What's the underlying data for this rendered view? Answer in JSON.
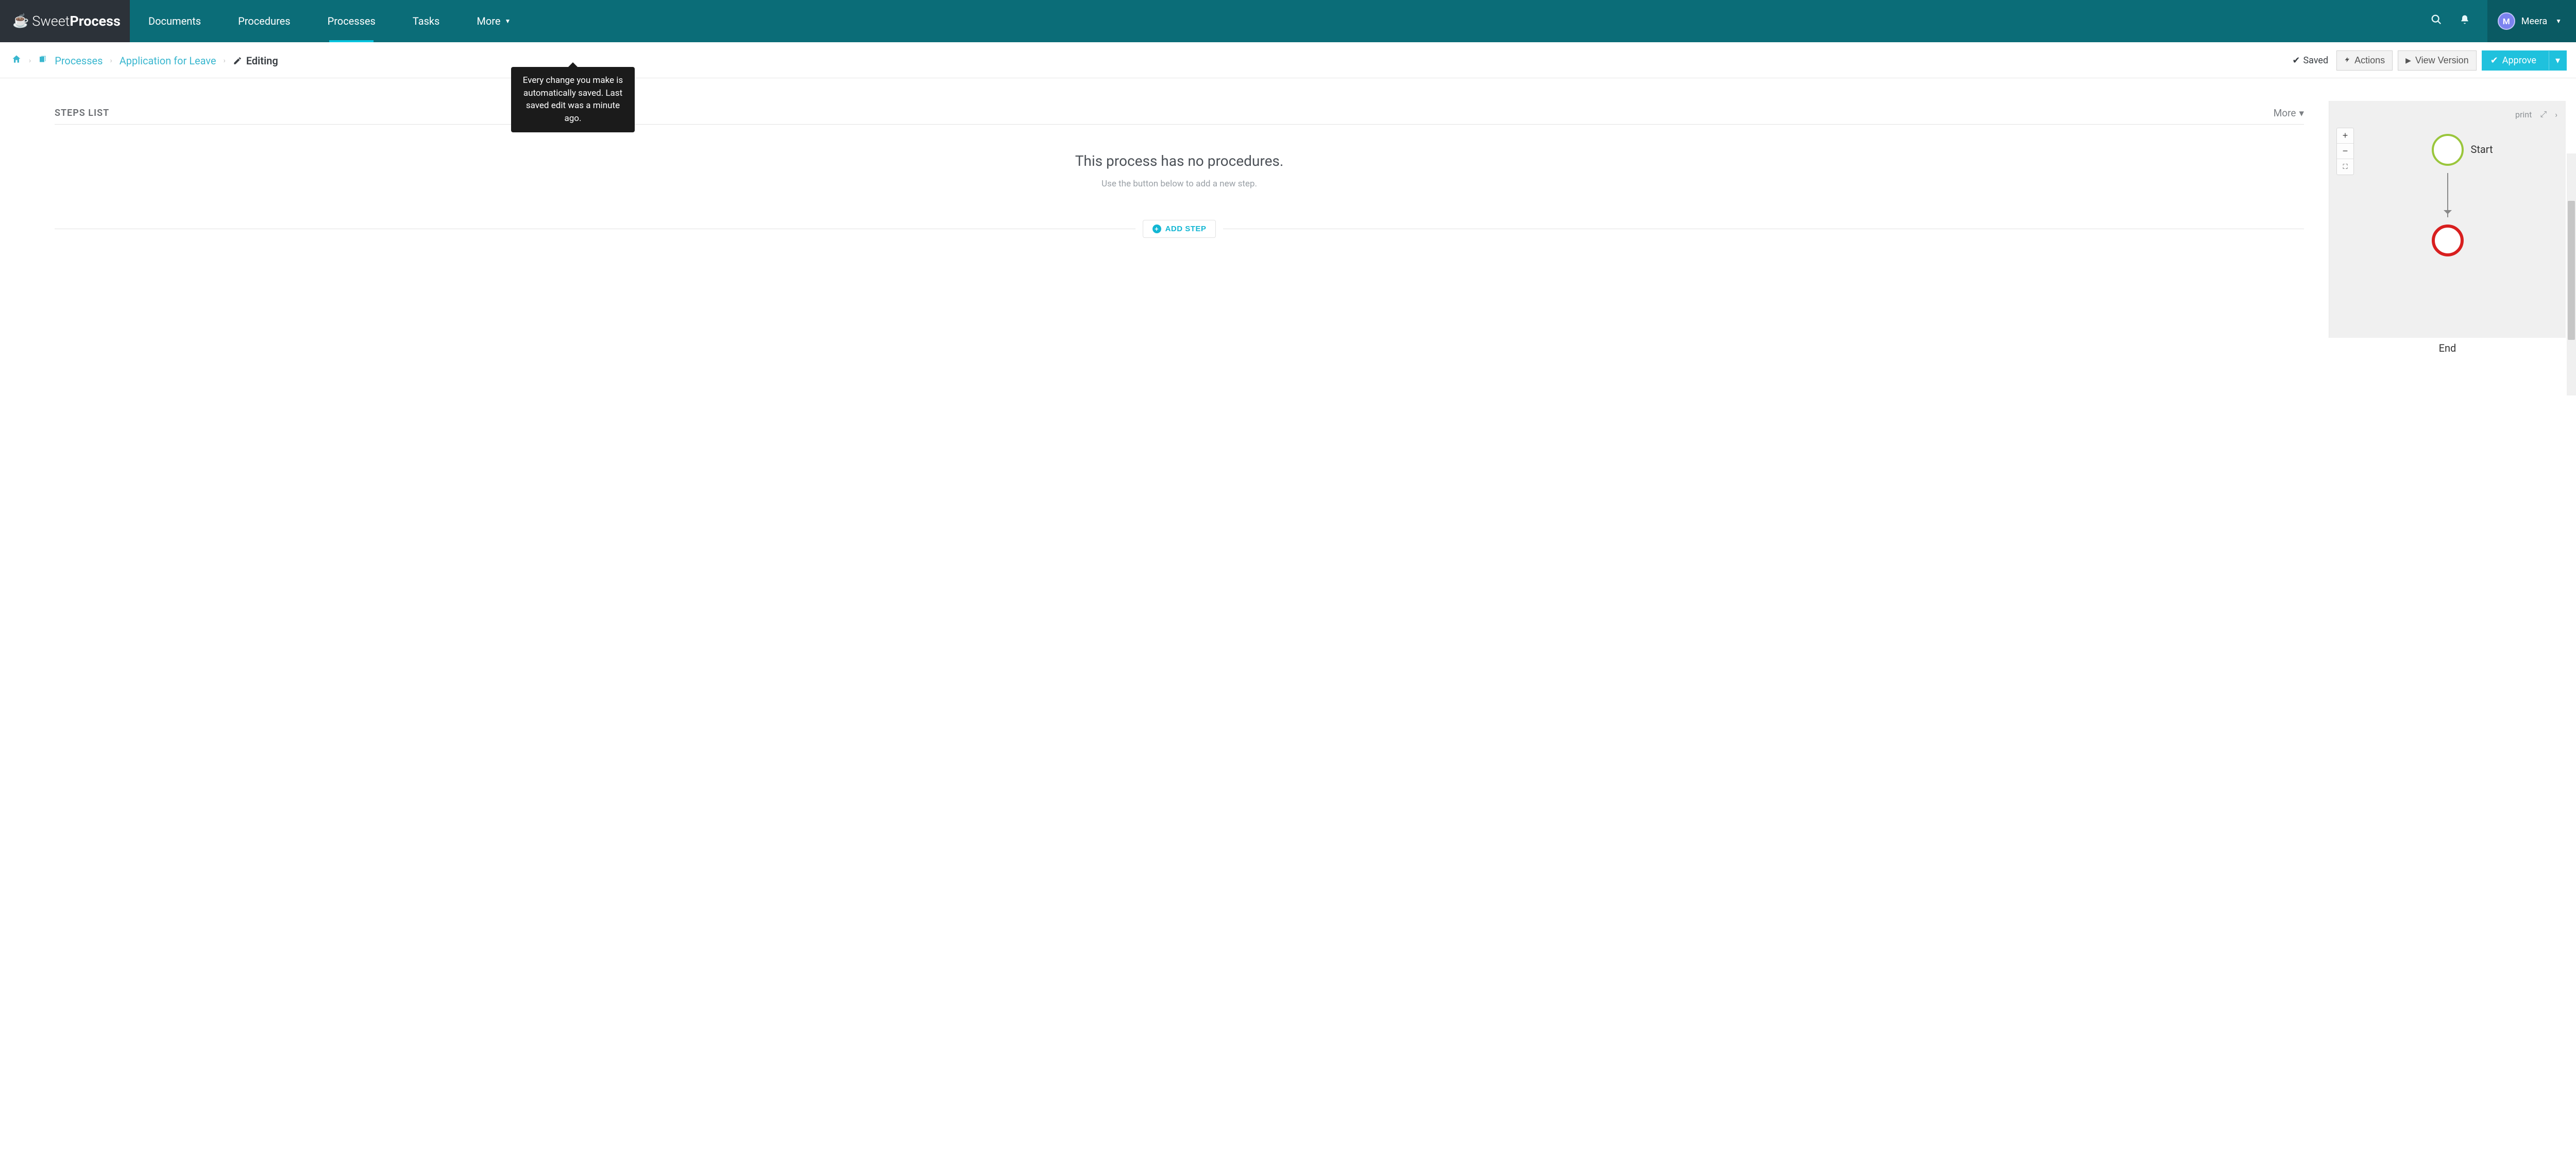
{
  "brand": {
    "thin": "Sweet",
    "bold": "Process"
  },
  "nav": {
    "documents": "Documents",
    "procedures": "Procedures",
    "processes": "Processes",
    "tasks": "Tasks",
    "more": "More"
  },
  "user": {
    "initial": "M",
    "name": "Meera"
  },
  "breadcrumb": {
    "processes": "Processes",
    "item": "Application for Leave",
    "editing": "Editing"
  },
  "subbar": {
    "saved": "Saved",
    "actions": "Actions",
    "view_version": "View Version",
    "approve": "Approve"
  },
  "tooltip": "Every change you make is automatically saved. Last saved edit was a minute ago.",
  "steps": {
    "title": "STEPS LIST",
    "more": "More",
    "empty_heading": "This process has no procedures.",
    "empty_sub": "Use the button below to add a new step.",
    "add": "ADD STEP"
  },
  "diagram": {
    "print": "print",
    "start": "Start",
    "end": "End"
  }
}
